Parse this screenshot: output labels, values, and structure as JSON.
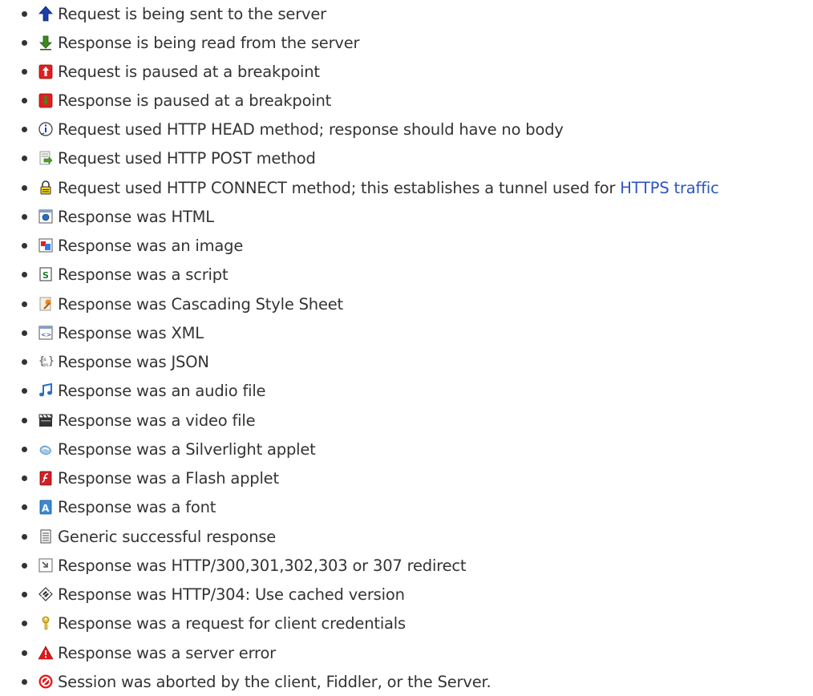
{
  "legend": {
    "items": [
      {
        "text": "Request is being sent to the server",
        "icon": "upload-arrow-icon"
      },
      {
        "text": "Response is being read from the server",
        "icon": "download-arrow-icon"
      },
      {
        "text": "Request is paused at a breakpoint",
        "icon": "request-breakpoint-icon"
      },
      {
        "text": "Response is paused at a breakpoint",
        "icon": "response-breakpoint-icon"
      },
      {
        "text": "Request used HTTP HEAD method; response should have no body",
        "icon": "head-info-icon"
      },
      {
        "text": "Request used HTTP POST method",
        "icon": "post-icon"
      },
      {
        "text": "Request used HTTP CONNECT method; this establishes a tunnel used for ",
        "link": "HTTPS traffic",
        "icon": "lock-icon"
      },
      {
        "text": "Response was HTML",
        "icon": "html-icon"
      },
      {
        "text": "Response was an image",
        "icon": "image-icon"
      },
      {
        "text": "Response was a script",
        "icon": "script-icon"
      },
      {
        "text": "Response was Cascading Style Sheet",
        "icon": "css-icon"
      },
      {
        "text": "Response was XML",
        "icon": "xml-icon"
      },
      {
        "text": "Response was JSON",
        "icon": "json-icon"
      },
      {
        "text": "Response was an audio file",
        "icon": "audio-icon"
      },
      {
        "text": "Response was a video file",
        "icon": "video-icon"
      },
      {
        "text": "Response was a Silverlight applet",
        "icon": "silverlight-icon"
      },
      {
        "text": "Response was a Flash applet",
        "icon": "flash-icon"
      },
      {
        "text": "Response was a font",
        "icon": "font-icon"
      },
      {
        "text": "Generic successful response",
        "icon": "generic-response-icon"
      },
      {
        "text": "Response was HTTP/300,301,302,303 or 307 redirect",
        "icon": "redirect-icon"
      },
      {
        "text": "Response was HTTP/304: Use cached version",
        "icon": "cached-icon"
      },
      {
        "text": "Response was a request for client credentials",
        "icon": "key-icon"
      },
      {
        "text": "Response was a server error",
        "icon": "warning-icon"
      },
      {
        "text": "Session was aborted by the client, Fiddler, or the Server.",
        "icon": "aborted-icon"
      }
    ]
  }
}
